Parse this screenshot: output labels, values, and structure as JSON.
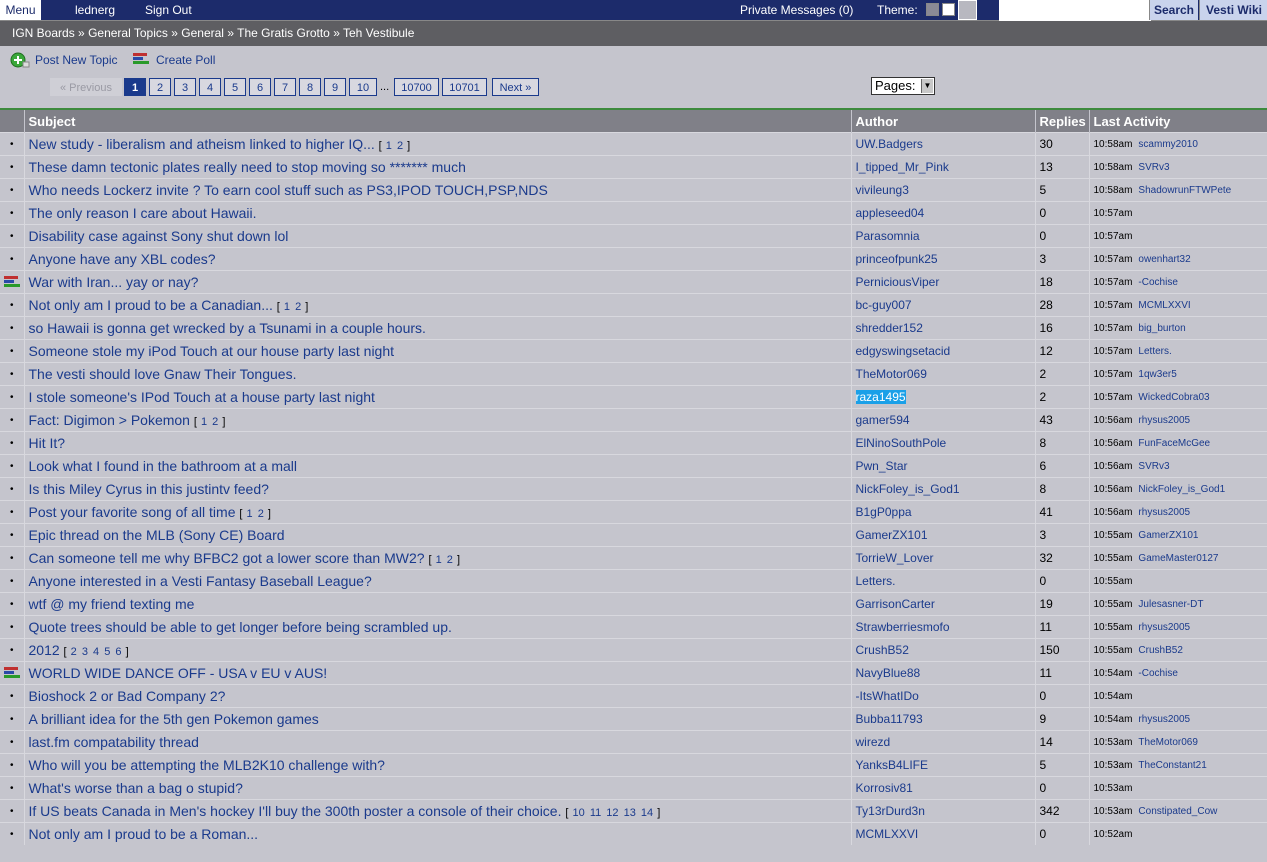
{
  "topbar": {
    "menu_label": "Menu",
    "username": "lednerg",
    "sign_out": "Sign Out",
    "private_messages": "Private Messages (0)",
    "theme_label": "Theme:",
    "search_button": "Search",
    "wiki_button": "Vesti Wiki",
    "search_value": ""
  },
  "breadcrumb": {
    "items": [
      "IGN Boards",
      "General Topics",
      "General",
      "The Gratis Grotto",
      "Teh Vestibule"
    ],
    "separator": "»"
  },
  "toolbar": {
    "post_new_topic": "Post New Topic",
    "create_poll": "Create Poll"
  },
  "pager": {
    "previous": "« Previous",
    "pages": [
      "1",
      "2",
      "3",
      "4",
      "5",
      "6",
      "7",
      "8",
      "9",
      "10"
    ],
    "ellipsis": "...",
    "page_10700": "10700",
    "page_10701": "10701",
    "next": "Next »",
    "select_label": "Pages:"
  },
  "columns": {
    "subject": "Subject",
    "author": "Author",
    "replies": "Replies",
    "last": "Last Activity"
  },
  "threads": [
    {
      "subject": "New study - liberalism and atheism linked to higher IQ...",
      "pages": "1 2",
      "author": "UW.Badgers",
      "replies": "30",
      "time": "10:58am",
      "by": "scammy2010"
    },
    {
      "subject": "These damn tectonic plates really need to stop moving so ******* much",
      "pages": "",
      "author": "I_tipped_Mr_Pink",
      "replies": "13",
      "time": "10:58am",
      "by": "SVRv3"
    },
    {
      "subject": "Who needs Lockerz invite ? To earn cool stuff such as PS3,IPOD TOUCH,PSP,NDS",
      "pages": "",
      "author": "vivileung3",
      "replies": "5",
      "time": "10:58am",
      "by": "ShadowrunFTWPete"
    },
    {
      "subject": "The only reason I care about Hawaii.",
      "pages": "",
      "author": "appleseed04",
      "replies": "0",
      "time": "10:57am",
      "by": ""
    },
    {
      "subject": "Disability case against Sony shut down lol",
      "pages": "",
      "author": "Parasomnia",
      "replies": "0",
      "time": "10:57am",
      "by": ""
    },
    {
      "subject": "Anyone have any XBL codes?",
      "pages": "",
      "author": "princeofpunk25",
      "replies": "3",
      "time": "10:57am",
      "by": "owenhart32"
    },
    {
      "subject": "War with Iran... yay or nay?",
      "pages": "",
      "author": "PerniciousViper",
      "replies": "18",
      "time": "10:57am",
      "by": "-Cochise",
      "poll": true
    },
    {
      "subject": "Not only am I proud to be a Canadian...",
      "pages": "1 2",
      "author": "bc-guy007",
      "replies": "28",
      "time": "10:57am",
      "by": "MCMLXXVI"
    },
    {
      "subject": "so Hawaii is gonna get wrecked by a Tsunami in a couple hours.",
      "pages": "",
      "author": "shredder152",
      "replies": "16",
      "time": "10:57am",
      "by": "big_burton"
    },
    {
      "subject": "Someone stole my iPod Touch at our house party last night",
      "pages": "",
      "author": "edgyswingsetacid",
      "replies": "12",
      "time": "10:57am",
      "by": "Letters."
    },
    {
      "subject": "The vesti should love Gnaw Their Tongues.",
      "pages": "",
      "author": "TheMotor069",
      "replies": "2",
      "time": "10:57am",
      "by": "1qw3er5"
    },
    {
      "subject": "I stole someone's IPod Touch at a house party last night",
      "pages": "",
      "author": "raza1495",
      "replies": "2",
      "time": "10:57am",
      "by": "WickedCobra03",
      "hl": true
    },
    {
      "subject": "Fact: Digimon > Pokemon",
      "pages": "1 2",
      "author": "gamer594",
      "replies": "43",
      "time": "10:56am",
      "by": "rhysus2005"
    },
    {
      "subject": "Hit It?",
      "pages": "",
      "author": "ElNinoSouthPole",
      "replies": "8",
      "time": "10:56am",
      "by": "FunFaceMcGee"
    },
    {
      "subject": "Look what I found in the bathroom at a mall",
      "pages": "",
      "author": "Pwn_Star",
      "replies": "6",
      "time": "10:56am",
      "by": "SVRv3"
    },
    {
      "subject": "Is this Miley Cyrus in this justintv feed?",
      "pages": "",
      "author": "NickFoley_is_God1",
      "replies": "8",
      "time": "10:56am",
      "by": "NickFoley_is_God1"
    },
    {
      "subject": "Post your favorite song of all time",
      "pages": "1 2",
      "author": "B1gP0ppa",
      "replies": "41",
      "time": "10:56am",
      "by": "rhysus2005"
    },
    {
      "subject": "Epic thread on the MLB (Sony CE) Board",
      "pages": "",
      "author": "GamerZX101",
      "replies": "3",
      "time": "10:55am",
      "by": "GamerZX101"
    },
    {
      "subject": "Can someone tell me why BFBC2 got a lower score than MW2?",
      "pages": "1 2",
      "author": "TorrieW_Lover",
      "replies": "32",
      "time": "10:55am",
      "by": "GameMaster0127"
    },
    {
      "subject": "Anyone interested in a Vesti Fantasy Baseball League?",
      "pages": "",
      "author": "Letters.",
      "replies": "0",
      "time": "10:55am",
      "by": ""
    },
    {
      "subject": "wtf @ my friend texting me",
      "pages": "",
      "author": "GarrisonCarter",
      "replies": "19",
      "time": "10:55am",
      "by": "Julesasner-DT"
    },
    {
      "subject": "Quote trees should be able to get longer before being scrambled up.",
      "pages": "",
      "author": "Strawberriesmofo",
      "replies": "11",
      "time": "10:55am",
      "by": "rhysus2005"
    },
    {
      "subject": "2012",
      "pages": "2 3 4 5 6",
      "author": "CrushB52",
      "replies": "150",
      "time": "10:55am",
      "by": "CrushB52"
    },
    {
      "subject": "WORLD WIDE DANCE OFF - USA v EU v AUS!",
      "pages": "",
      "author": "NavyBlue88",
      "replies": "11",
      "time": "10:54am",
      "by": "-Cochise",
      "poll": true
    },
    {
      "subject": "Bioshock 2 or Bad Company 2?",
      "pages": "",
      "author": "-ItsWhatIDo",
      "replies": "0",
      "time": "10:54am",
      "by": ""
    },
    {
      "subject": "A brilliant idea for the 5th gen Pokemon games",
      "pages": "",
      "author": "Bubba11793",
      "replies": "9",
      "time": "10:54am",
      "by": "rhysus2005"
    },
    {
      "subject": "last.fm compatability thread",
      "pages": "",
      "author": "wirezd",
      "replies": "14",
      "time": "10:53am",
      "by": "TheMotor069"
    },
    {
      "subject": "Who will you be attempting the MLB2K10 challenge with?",
      "pages": "",
      "author": "YanksB4LIFE",
      "replies": "5",
      "time": "10:53am",
      "by": "TheConstant21"
    },
    {
      "subject": "What's worse than a bag o stupid?",
      "pages": "",
      "author": "Korrosiv81",
      "replies": "0",
      "time": "10:53am",
      "by": ""
    },
    {
      "subject": "If US beats Canada in Men's hockey I'll buy the 300th poster a console of their choice.",
      "pages": "10 11 12 13 14",
      "author": "Ty13rDurd3n",
      "replies": "342",
      "time": "10:53am",
      "by": "Constipated_Cow"
    },
    {
      "subject": "Not only am I proud to be a Roman...",
      "pages": "",
      "author": "MCMLXXVI",
      "replies": "0",
      "time": "10:52am",
      "by": ""
    }
  ]
}
